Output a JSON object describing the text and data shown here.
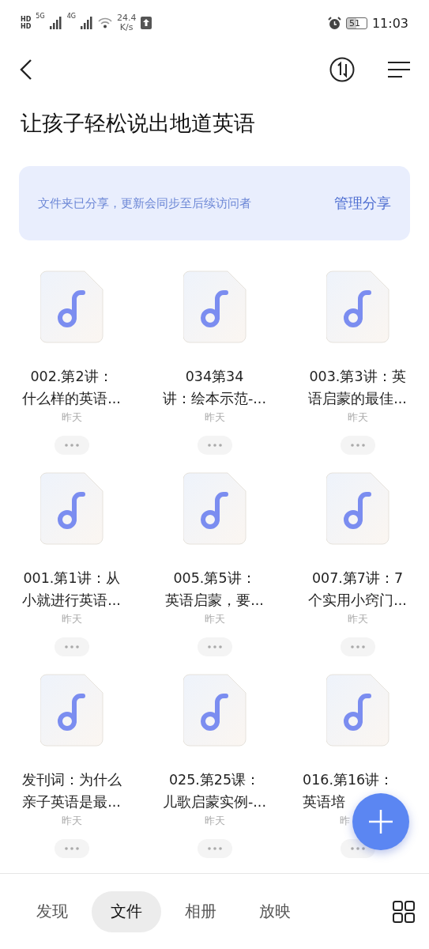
{
  "status_bar": {
    "sim_labels": [
      "HD",
      "HD"
    ],
    "networks": [
      "5G",
      "4G"
    ],
    "speed": [
      "24.4",
      "K/s"
    ],
    "battery": "51",
    "time": "11:03"
  },
  "title": "让孩子轻松说出地道英语",
  "share_banner": {
    "message": "文件夹已分享，更新会同步至后续访问者",
    "action": "管理分享"
  },
  "files": [
    {
      "name_lines": [
        "002.第2讲：",
        "什么样的英语..."
      ],
      "date": "昨天",
      "partly_covered": false
    },
    {
      "name_lines": [
        "034第34",
        "讲：绘本示范-..."
      ],
      "date": "昨天",
      "partly_covered": false
    },
    {
      "name_lines": [
        "003.第3讲：英",
        "语启蒙的最佳..."
      ],
      "date": "昨天",
      "partly_covered": false
    },
    {
      "name_lines": [
        "001.第1讲：从",
        "小就进行英语..."
      ],
      "date": "昨天",
      "partly_covered": false
    },
    {
      "name_lines": [
        "005.第5讲：",
        "英语启蒙，要..."
      ],
      "date": "昨天",
      "partly_covered": false
    },
    {
      "name_lines": [
        "007.第7讲：7",
        "个实用小窍门..."
      ],
      "date": "昨天",
      "partly_covered": false
    },
    {
      "name_lines": [
        "发刊词：为什么",
        "亲子英语是最..."
      ],
      "date": "昨天",
      "partly_covered": false
    },
    {
      "name_lines": [
        "025.第25课：",
        "儿歌启蒙实例-..."
      ],
      "date": "昨天",
      "partly_covered": false
    },
    {
      "name_lines": [
        "016.第16讲：",
        "英语培"
      ],
      "date": "昨",
      "partly_covered": true
    }
  ],
  "bottom_tabs": [
    {
      "label": "发现",
      "selected": false
    },
    {
      "label": "文件",
      "selected": true
    },
    {
      "label": "相册",
      "selected": false
    },
    {
      "label": "放映",
      "selected": false
    }
  ]
}
